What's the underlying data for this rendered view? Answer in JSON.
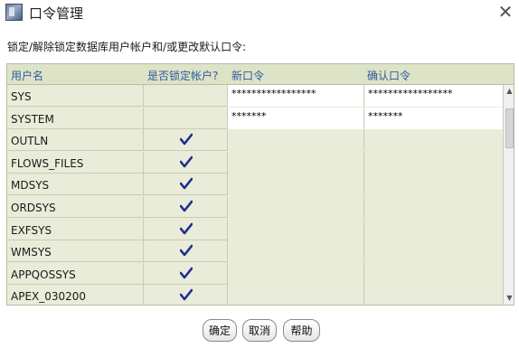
{
  "window": {
    "title": "口令管理",
    "icon": "app-icon",
    "close_icon": "close-icon"
  },
  "instruction": "锁定/解除锁定数据库用户帐户和/或更改默认口令:",
  "table": {
    "columns": [
      "用户名",
      "是否锁定帐户?",
      "新口令",
      "确认口令"
    ],
    "rows": [
      {
        "user": "SYS",
        "locked": false,
        "new_password": "*****************",
        "confirm_password": "*****************"
      },
      {
        "user": "SYSTEM",
        "locked": false,
        "new_password": "*******",
        "confirm_password": "*******"
      },
      {
        "user": "OUTLN",
        "locked": true,
        "new_password": "",
        "confirm_password": ""
      },
      {
        "user": "FLOWS_FILES",
        "locked": true,
        "new_password": "",
        "confirm_password": ""
      },
      {
        "user": "MDSYS",
        "locked": true,
        "new_password": "",
        "confirm_password": ""
      },
      {
        "user": "ORDSYS",
        "locked": true,
        "new_password": "",
        "confirm_password": ""
      },
      {
        "user": "EXFSYS",
        "locked": true,
        "new_password": "",
        "confirm_password": ""
      },
      {
        "user": "WMSYS",
        "locked": true,
        "new_password": "",
        "confirm_password": ""
      },
      {
        "user": "APPQOSSYS",
        "locked": true,
        "new_password": "",
        "confirm_password": ""
      },
      {
        "user": "APEX_030200",
        "locked": true,
        "new_password": "",
        "confirm_password": ""
      }
    ]
  },
  "buttons": {
    "ok": "确定",
    "cancel": "取消",
    "help": "帮助"
  },
  "colors": {
    "header_text": "#2f5a9e",
    "grid_bg": "#e9ecd9",
    "check": "#1f2f8f"
  }
}
